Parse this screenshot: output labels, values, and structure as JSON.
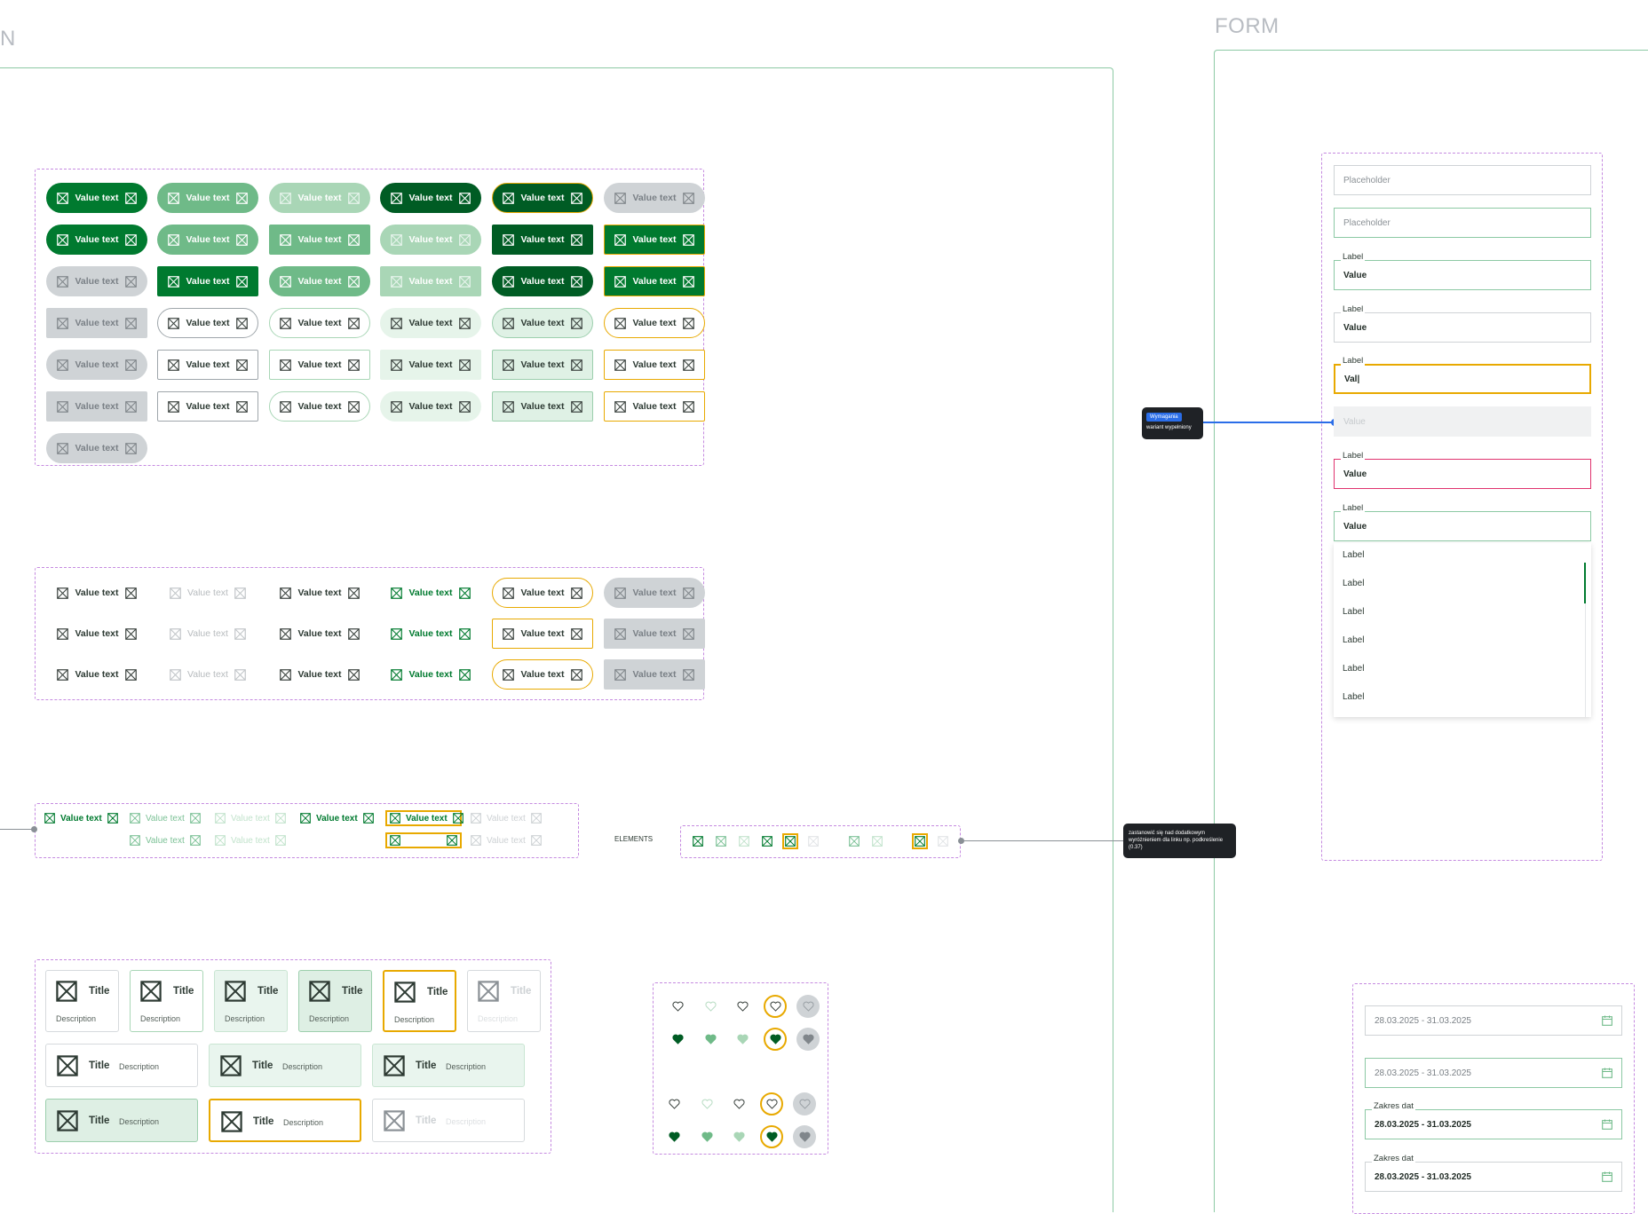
{
  "frames": {
    "left_title_fragment": "N",
    "form_title": "FORM",
    "elements_label": "ELEMENTS"
  },
  "colors": {
    "primary": "#007a2f",
    "primary_dark": "#005c24",
    "primary_medium": "#6fba88",
    "primary_light": "#a9d6b6",
    "focus": "#e8a900",
    "error": "#e0336e",
    "frame_border": "#8cc9a4",
    "section_dashed": "#c58ae0",
    "tooltip_bg": "#1f2226",
    "tag_blue": "#2a6de8"
  },
  "chip_label": "Value text",
  "cards": {
    "title": "Title",
    "description": "Description"
  },
  "form": {
    "placeholder": "Placeholder",
    "label": "Label",
    "value": "Value",
    "typing_value": "Val|",
    "disabled_value": "Value",
    "dropdown_items": [
      "Label",
      "Label",
      "Label",
      "Label",
      "Label",
      "Label"
    ],
    "date_label": "Zakres dat",
    "date_value": "28.03.2025 - 31.03.2025"
  },
  "tooltips": {
    "required_tag": "Wymagania",
    "required_text": "wariant wypełniony",
    "links_note": "zastanowić się nad dodatkowym wyróżnieniem dla linku np. podkreślenie (0.37)"
  },
  "icons": {
    "placeholder": "image-placeholder-icon",
    "heart": "heart-icon",
    "calendar": "calendar-icon"
  }
}
